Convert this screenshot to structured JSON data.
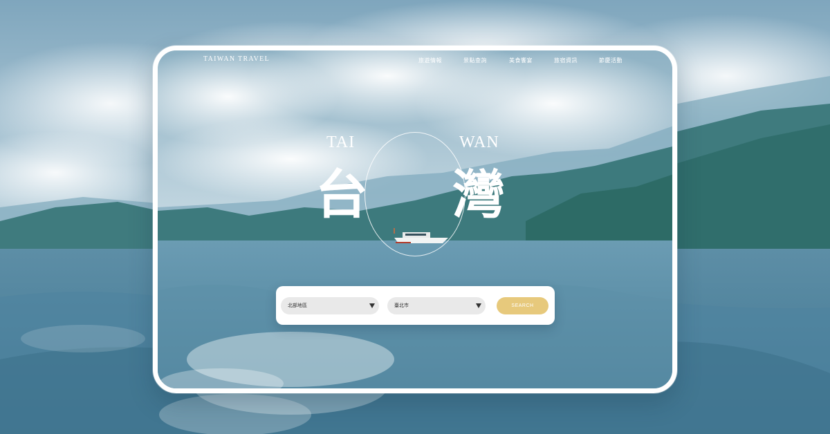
{
  "brand": "TAIWAN TRAVEL",
  "nav": {
    "items": [
      "旅遊情報",
      "景點查詢",
      "美食饗宴",
      "旅宿資訊",
      "節慶活動"
    ]
  },
  "hero": {
    "latin_left": "TAI",
    "latin_right": "WAN",
    "han_left": "台",
    "han_right": "灣"
  },
  "search": {
    "region_value": "北部地區",
    "city_value": "臺北市",
    "button_label": "SEARCH"
  },
  "colors": {
    "accent": "#e7c97c",
    "select_bg": "#e9e9e9",
    "frame": "#ffffff"
  }
}
